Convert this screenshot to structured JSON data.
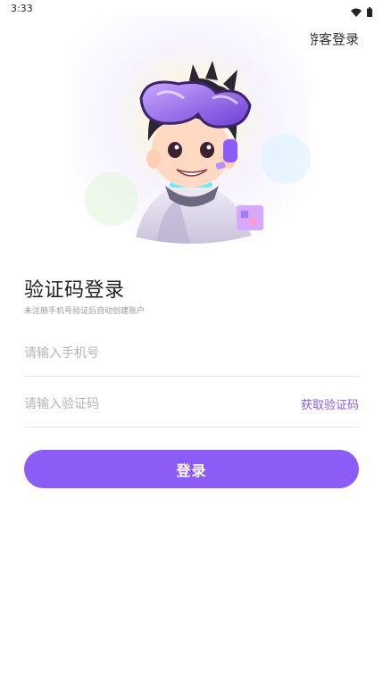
{
  "status_bar": {
    "time": "3:33",
    "icons": [
      "wifi-icon",
      "battery-icon"
    ]
  },
  "header": {
    "guest_login": "游客登录"
  },
  "hero": {
    "icon": "avatar-illustration"
  },
  "login": {
    "title": "验证码登录",
    "subtitle": "未注册手机号验证后自动创建账户",
    "phone_placeholder": "请输入手机号",
    "code_placeholder": "请输入验证码",
    "get_code": "获取验证码",
    "submit": "登录"
  },
  "colors": {
    "accent": "#8b5cf6",
    "link": "#8a5cf0"
  }
}
